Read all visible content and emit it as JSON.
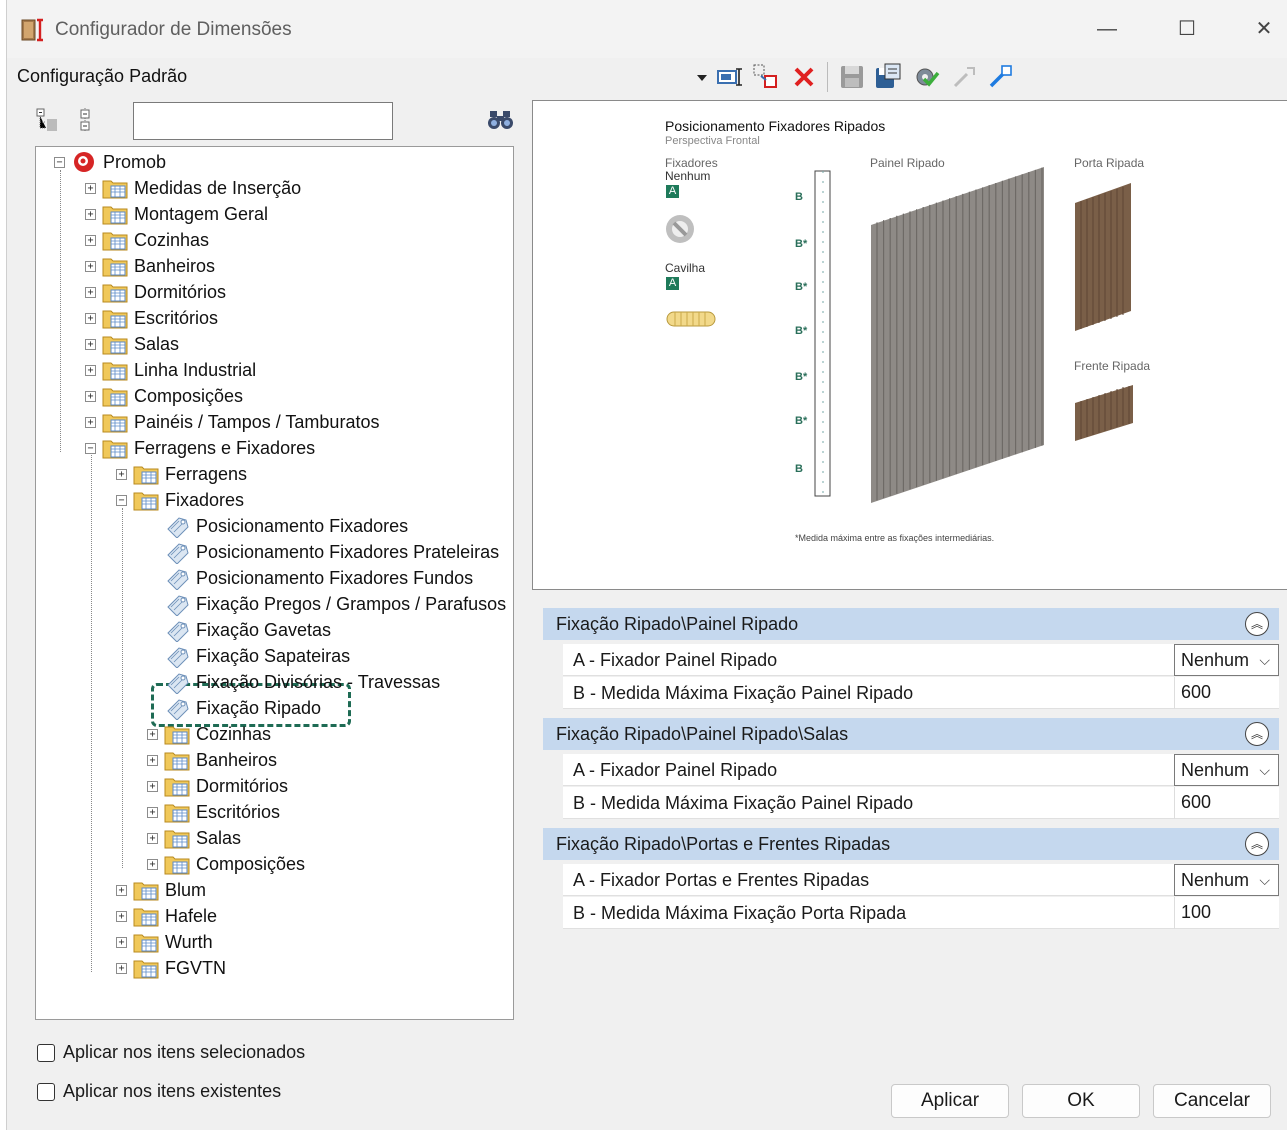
{
  "window": {
    "title": "Configurador de Dimensões",
    "minimize": "—",
    "maximize": "☐",
    "close": "✕"
  },
  "toolbar": {
    "config_name": "Configuração Padrão"
  },
  "tree": {
    "root": "Promob",
    "l1": [
      "Medidas de Inserção",
      "Montagem Geral",
      "Cozinhas",
      "Banheiros",
      "Dormitórios",
      "Escritórios",
      "Salas",
      "Linha Industrial",
      "Composições",
      "Painéis / Tampos / Tamburatos",
      "Ferragens e Fixadores"
    ],
    "l2": [
      "Ferragens",
      "Fixadores"
    ],
    "fixadores_items": [
      "Posicionamento Fixadores",
      "Posicionamento Fixadores Prateleiras",
      "Posicionamento Fixadores Fundos",
      "Fixação Pregos / Grampos / Parafusos",
      "Fixação Gavetas",
      "Fixação Sapateiras",
      "Fixação Divisórias - Travessas",
      "Fixação Ripado"
    ],
    "fixadores_folders": [
      "Cozinhas",
      "Banheiros",
      "Dormitórios",
      "Escritórios",
      "Salas",
      "Composições"
    ],
    "l2_after": [
      "Blum",
      "Hafele",
      "Wurth",
      "FGVTN"
    ]
  },
  "preview": {
    "title": "Posicionamento Fixadores Ripados",
    "subtitle": "Perspectiva Frontal",
    "fixadores_label": "Fixadores",
    "nenhum_label": "Nenhum",
    "badge_a": "A",
    "cavilha_label": "Cavilha",
    "painel_label": "Painel Ripado",
    "porta_label": "Porta Ripada",
    "frente_label": "Frente Ripada",
    "dim_labels": [
      "B",
      "B*",
      "B*",
      "B*",
      "B*",
      "B*",
      "B"
    ],
    "footnote": "*Medida máxima entre as fixações intermediárias."
  },
  "sections": [
    {
      "title": "Fixação Ripado\\Painel Ripado",
      "rows": [
        {
          "label": "A - Fixador Painel Ripado",
          "value": "Nenhum",
          "type": "select"
        },
        {
          "label": "B - Medida Máxima Fixação Painel Ripado",
          "value": "600",
          "type": "text"
        }
      ]
    },
    {
      "title": "Fixação Ripado\\Painel Ripado\\Salas",
      "rows": [
        {
          "label": "A - Fixador Painel Ripado",
          "value": "Nenhum",
          "type": "select"
        },
        {
          "label": "B - Medida Máxima Fixação Painel Ripado",
          "value": "600",
          "type": "text"
        }
      ]
    },
    {
      "title": "Fixação Ripado\\Portas e Frentes Ripadas",
      "rows": [
        {
          "label": "A - Fixador Portas e Frentes Ripadas",
          "value": "Nenhum",
          "type": "select"
        },
        {
          "label": "B - Medida Máxima Fixação Porta Ripada",
          "value": "100",
          "type": "text"
        }
      ]
    }
  ],
  "checkboxes": {
    "selected": "Aplicar nos itens selecionados",
    "existing": "Aplicar nos itens existentes"
  },
  "buttons": {
    "apply": "Aplicar",
    "ok": "OK",
    "cancel": "Cancelar"
  },
  "colors": {
    "section_bg": "#c5d8ee",
    "highlight": "#1e6b54",
    "badge": "#1e7a5a"
  }
}
